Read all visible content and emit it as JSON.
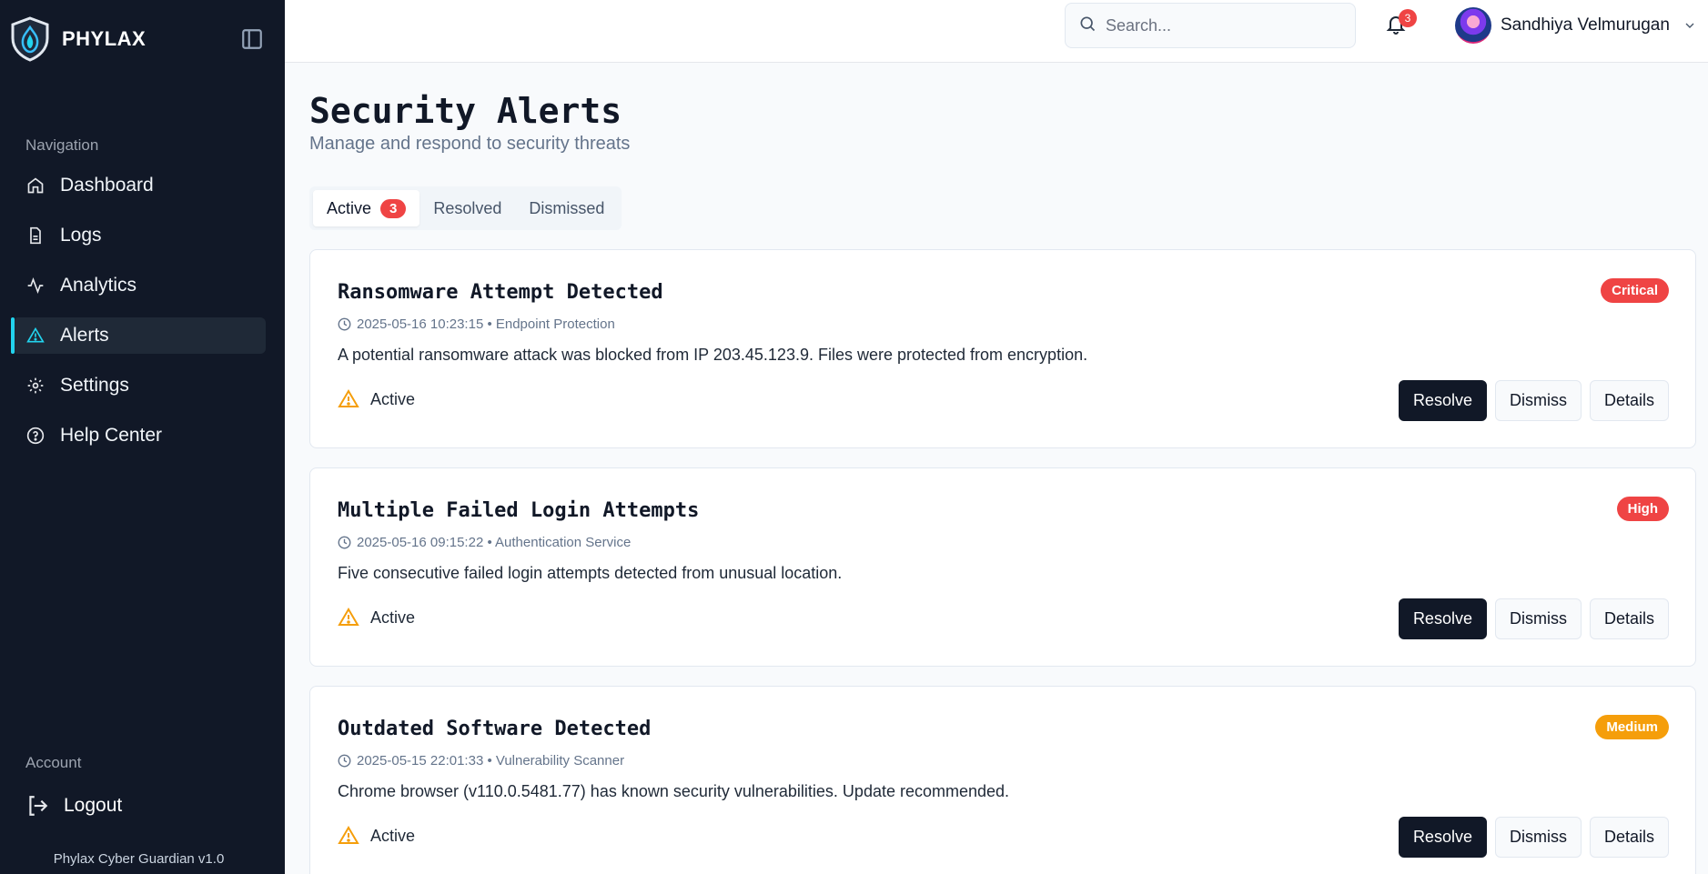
{
  "app": {
    "name": "PHYLAX",
    "version": "Phylax Cyber Guardian v1.0"
  },
  "sidebar": {
    "section_label": "Navigation",
    "items": [
      {
        "label": "Dashboard",
        "icon": "home-icon"
      },
      {
        "label": "Logs",
        "icon": "file-text-icon"
      },
      {
        "label": "Analytics",
        "icon": "activity-icon"
      },
      {
        "label": "Alerts",
        "icon": "alert-triangle-icon",
        "active": true
      },
      {
        "label": "Settings",
        "icon": "gear-icon"
      },
      {
        "label": "Help Center",
        "icon": "help-circle-icon"
      }
    ],
    "account_label": "Account",
    "logout_label": "Logout"
  },
  "header": {
    "search_placeholder": "Search...",
    "notification_count": "3",
    "user_name": "Sandhiya Velmurugan"
  },
  "page": {
    "title": "Security Alerts",
    "subtitle": "Manage and respond to security threats"
  },
  "tabs": [
    {
      "label": "Active",
      "badge": "3",
      "active": true
    },
    {
      "label": "Resolved"
    },
    {
      "label": "Dismissed"
    }
  ],
  "colors": {
    "accent": "#22d3ee",
    "critical": "#ef4444",
    "high": "#ef4444",
    "medium": "#f59e0b",
    "warning_icon": "#f59e0b"
  },
  "alerts": [
    {
      "title": "Ransomware Attempt Detected",
      "timestamp": "2025-05-16 10:23:15",
      "source": "Endpoint Protection",
      "meta": "2025-05-16 10:23:15 • Endpoint Protection",
      "description": "A potential ransomware attack was blocked from IP 203.45.123.9. Files were protected from encryption.",
      "severity": "Critical",
      "severity_color": "#ef4444",
      "status": "Active"
    },
    {
      "title": "Multiple Failed Login Attempts",
      "timestamp": "2025-05-16 09:15:22",
      "source": "Authentication Service",
      "meta": "2025-05-16 09:15:22 • Authentication Service",
      "description": "Five consecutive failed login attempts detected from unusual location.",
      "severity": "High",
      "severity_color": "#ef4444",
      "status": "Active"
    },
    {
      "title": "Outdated Software Detected",
      "timestamp": "2025-05-15 22:01:33",
      "source": "Vulnerability Scanner",
      "meta": "2025-05-15 22:01:33 • Vulnerability Scanner",
      "description": "Chrome browser (v110.0.5481.77) has known security vulnerabilities. Update recommended.",
      "severity": "Medium",
      "severity_color": "#f59e0b",
      "status": "Active"
    }
  ],
  "actions": {
    "resolve": "Resolve",
    "dismiss": "Dismiss",
    "details": "Details"
  }
}
